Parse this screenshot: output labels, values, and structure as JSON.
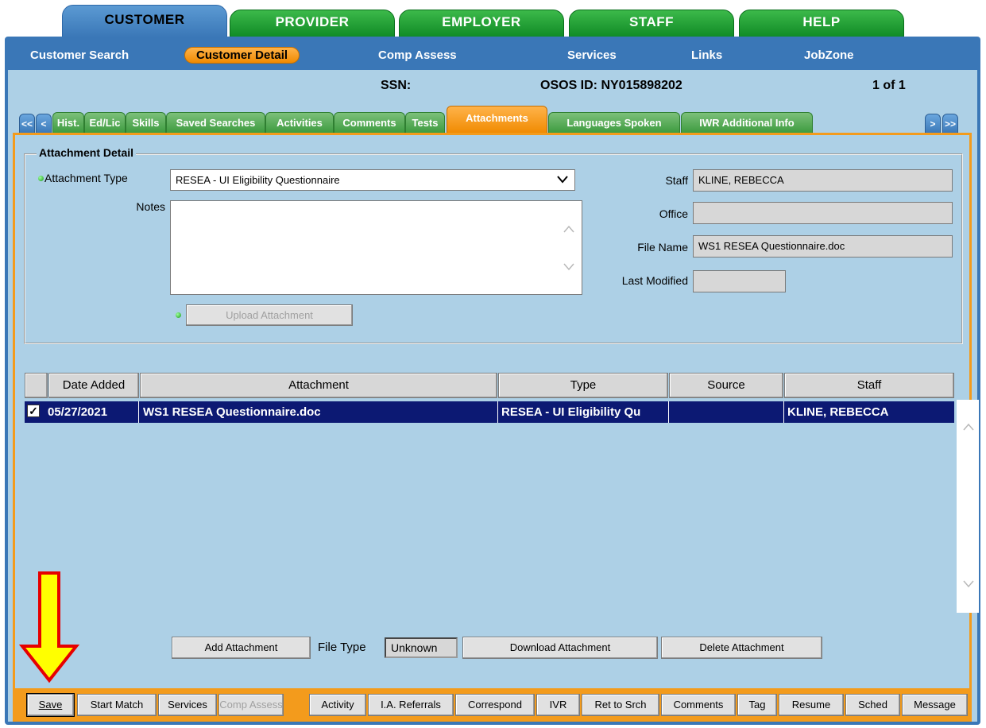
{
  "top_tabs": {
    "customer": "CUSTOMER",
    "provider": "PROVIDER",
    "employer": "EMPLOYER",
    "staff": "STAFF",
    "help": "HELP"
  },
  "nav": {
    "customer_search": "Customer Search",
    "customer_detail": "Customer Detail",
    "comp_assess": "Comp Assess",
    "services": "Services",
    "links": "Links",
    "jobzone": "JobZone"
  },
  "info": {
    "ssn_label": "SSN:",
    "osos_id": "OSOS ID: NY015898202",
    "record_count": "1 of 1"
  },
  "sub_tabs": {
    "first": "<<",
    "prev": "<",
    "hist": "Hist.",
    "edlic": "Ed/Lic",
    "skills": "Skills",
    "saved_searches": "Saved Searches",
    "activities": "Activities",
    "comments": "Comments",
    "tests": "Tests",
    "attachments": "Attachments",
    "languages": "Languages Spoken",
    "iwr": "IWR Additional Info",
    "next": ">",
    "last": ">>"
  },
  "detail": {
    "group_title": "Attachment Detail",
    "attachment_type_label": "Attachment Type",
    "attachment_type_value": "RESEA - UI Eligibility Questionnaire",
    "notes_label": "Notes",
    "notes_value": "",
    "upload_button": "Upload Attachment",
    "staff_label": "Staff",
    "staff_value": "KLINE, REBECCA",
    "office_label": "Office",
    "office_value": "",
    "file_name_label": "File Name",
    "file_name_value": "WS1 RESEA Questionnaire.doc",
    "last_modified_label": "Last Modified",
    "last_modified_value": ""
  },
  "table": {
    "headers": [
      "Date Added",
      "Attachment",
      "Type",
      "Source",
      "Staff"
    ],
    "rows": [
      {
        "checked": "✓",
        "date_added": "05/27/2021",
        "attachment": "WS1 RESEA Questionnaire.doc",
        "type": "RESEA - UI Eligibility Qu",
        "source": "",
        "staff": "KLINE, REBECCA"
      }
    ]
  },
  "actions": {
    "add_attachment": "Add Attachment",
    "file_type_label": "File Type",
    "file_type_value": "Unknown",
    "download_attachment": "Download Attachment",
    "delete_attachment": "Delete Attachment"
  },
  "toolbar": {
    "save": "Save",
    "start_match": "Start Match",
    "services": "Services",
    "comp_assess": "Comp Assess",
    "activity": "Activity",
    "ia_referrals": "I.A. Referrals",
    "correspond": "Correspond",
    "ivr": "IVR",
    "ret_to_srch": "Ret to Srch",
    "comments": "Comments",
    "tag": "Tag",
    "resume": "Resume",
    "sched": "Sched",
    "message": "Message"
  },
  "colors": {
    "accent_orange": "#f39b1c",
    "tab_green": "#1f9a33",
    "header_blue": "#3a77b7",
    "panel_blue": "#add0e6",
    "selection_navy": "#0c1973",
    "arrow_yellow": "#ffff00",
    "arrow_red": "#e60000"
  }
}
